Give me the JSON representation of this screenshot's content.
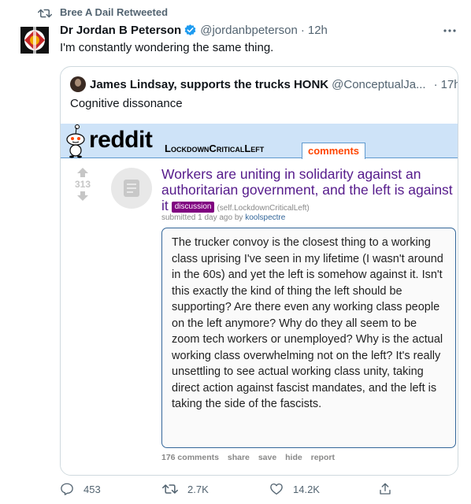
{
  "retweet": {
    "label": "Bree A Dail Retweeted"
  },
  "tweet": {
    "author_name": "Dr Jordan B Peterson",
    "handle": "@jordanbpeterson",
    "separator": "·",
    "time": "12h",
    "text": "I'm constantly wondering the same thing."
  },
  "quote": {
    "author_name": "James Lindsay, supports the trucks HONK",
    "handle": "@ConceptualJa...",
    "separator": "·",
    "time": "17h",
    "text": "Cognitive dissonance"
  },
  "reddit": {
    "logo_text": "reddit",
    "subreddit": "LockdownCriticalLeft",
    "tab": "comments",
    "score": "313",
    "title": "Workers are uniting in solidarity against an authoritarian government, and the left is against it",
    "flair": "discussion",
    "domain": "(self.LockdownCriticalLeft)",
    "submitted_prefix": "submitted 1 day ago by",
    "author": "koolspectre",
    "body": "The trucker convoy is the closest thing to a working class uprising I've seen in my lifetime (I wasn't around in the 60s) and yet the left is somehow against it. Isn't this exactly the kind of thing the left should be supporting? Are there even any working class people on the left anymore? Why do they all seem to be zoom tech workers or unemployed? Why is the actual working class overwhelming not on the left? It's really unsettling to see actual working class unity, taking direct action against fascist mandates, and the left is taking the side of the fascists.",
    "actions": {
      "comments": "176 comments",
      "share": "share",
      "save": "save",
      "hide": "hide",
      "report": "report"
    }
  },
  "actions": {
    "replies": "453",
    "retweets": "2.7K",
    "likes": "14.2K"
  },
  "colors": {
    "verified": "#1d9bf0",
    "reddit_bar": "#cee3f8",
    "title_link": "#551a8b",
    "flair": "#800080",
    "tab_text": "#ff4500",
    "muted": "#536471"
  }
}
